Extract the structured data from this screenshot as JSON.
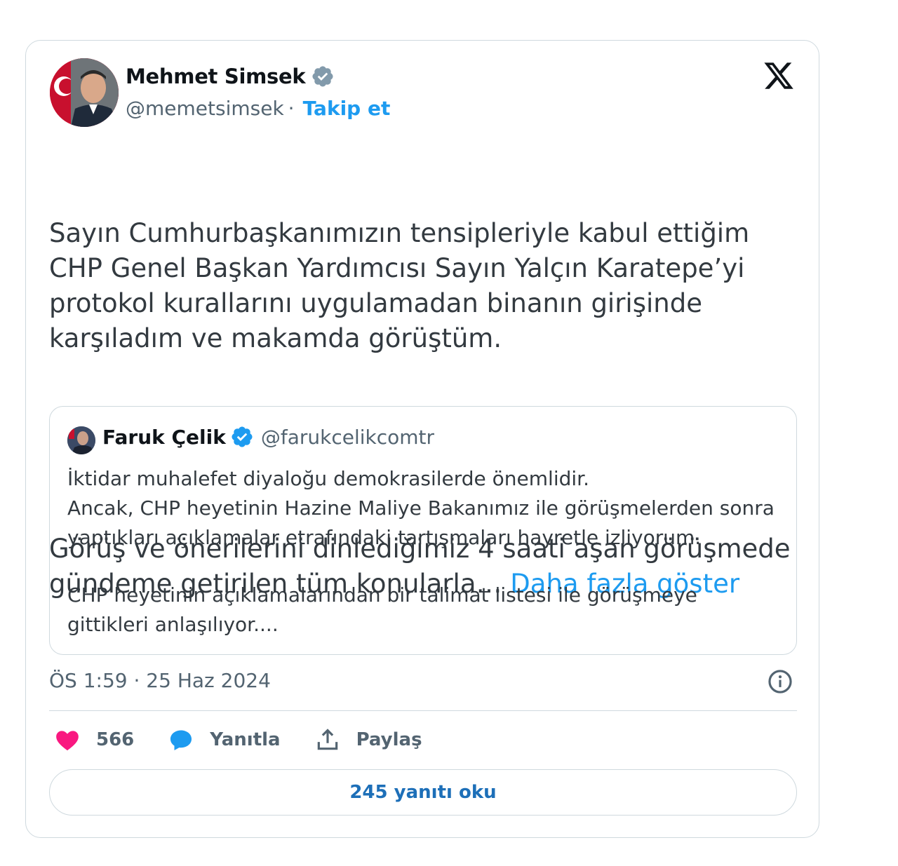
{
  "author": {
    "display_name": "Mehmet Simsek",
    "handle": "@memetsimsek",
    "separator": "·",
    "follow_label": "Takip et"
  },
  "tweet": {
    "paragraph_1": "Sayın Cumhurbaşkanımızın tensipleriyle kabul ettiğim CHP Genel Başkan Yardımcısı Sayın Yalçın Karatepe’yi protokol kurallarını uygulamadan binanın girişinde karşıladım ve makamda görüştüm.",
    "paragraph_2": "Görüş ve önerilerini dinlediğimiz 4 saati aşan görüşmede gündeme getirilen tüm konularla… ",
    "show_more": "Daha fazla göster"
  },
  "quote": {
    "display_name": "Faruk Çelik",
    "handle": "@farukcelikcomtr",
    "line_1": "İktidar muhalefet diyaloğu demokrasilerde önemlidir.",
    "line_2": "Ancak, CHP heyetinin Hazine Maliye Bakanımız ile görüşmelerden sonra yaptıkları açıklamalar etrafındaki tartışmaları hayretle izliyorum.",
    "line_3": "CHP heyetinin açıklamalarından bir talimat listesi ile görüşmeye gittikleri anlaşılıyor...."
  },
  "timestamp": "ÖS 1:59 · 25 Haz 2024",
  "actions": {
    "likes": "566",
    "reply_label": "Yanıtla",
    "share_label": "Paylaş"
  },
  "read_replies": "245 yanıtı oku",
  "colors": {
    "accent": "#1d9bf0",
    "like": "#f91880",
    "border": "#cfd9de",
    "muted": "#536471"
  }
}
